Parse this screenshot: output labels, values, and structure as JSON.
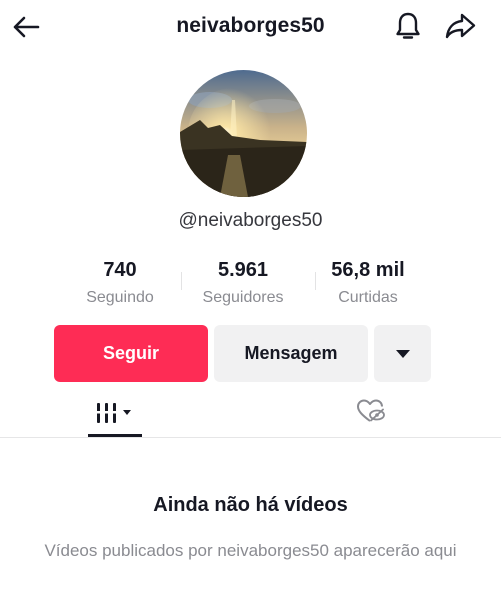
{
  "header": {
    "title": "neivaborges50",
    "back_icon": "arrow-left-icon",
    "bell_icon": "bell-icon",
    "share_icon": "share-arrow-icon"
  },
  "profile": {
    "handle": "@neivaborges50",
    "avatar": "sunset-landscape-photo"
  },
  "stats": [
    {
      "value": "740",
      "label": "Seguindo"
    },
    {
      "value": "5.961",
      "label": "Seguidores"
    },
    {
      "value": "56,8 mil",
      "label": "Curtidas"
    }
  ],
  "actions": {
    "follow_label": "Seguir",
    "message_label": "Mensagem",
    "more_icon": "caret-down-icon"
  },
  "tabs": {
    "videos_icon": "grid-videos-icon",
    "liked_icon": "liked-hidden-icon"
  },
  "empty_state": {
    "title": "Ainda não há vídeos",
    "description": "Vídeos publicados por neivaborges50 aparecerão aqui"
  },
  "colors": {
    "accent": "#fe2c55",
    "secondary_button": "#f1f1f2",
    "text_primary": "#161823",
    "text_secondary": "#8a8b91"
  }
}
